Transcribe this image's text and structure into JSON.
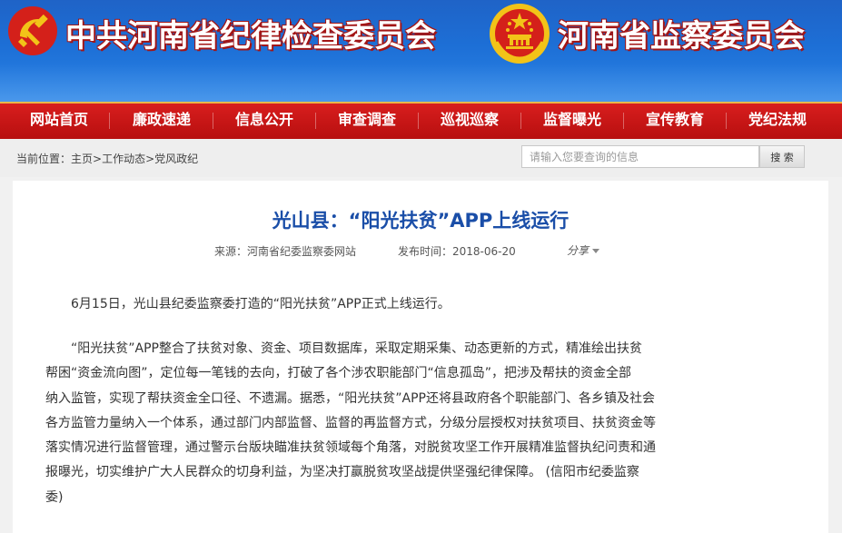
{
  "header": {
    "title_left": "中共河南省纪律检查委员会",
    "title_right": "河南省监察委员会",
    "left_emblem_icon": "hammer-sickle-emblem-icon",
    "right_emblem_icon": "national-emblem-icon"
  },
  "nav": {
    "items": [
      {
        "label": "网站首页"
      },
      {
        "label": "廉政速递"
      },
      {
        "label": "信息公开"
      },
      {
        "label": "审查调查"
      },
      {
        "label": "巡视巡察"
      },
      {
        "label": "监督曝光"
      },
      {
        "label": "宣传教育"
      },
      {
        "label": "党纪法规"
      }
    ]
  },
  "breadcrumb": {
    "prefix": "当前位置：",
    "items": [
      "主页",
      "工作动态",
      "党风政纪"
    ],
    "sep": ">"
  },
  "search": {
    "placeholder": "请输入您要查询的信息",
    "button_label": "搜 索"
  },
  "article": {
    "title": "光山县：“阳光扶贫”APP上线运行",
    "source_label": "来源：",
    "source": "河南省纪委监察委网站",
    "date_label": "发布时间：",
    "date": "2018-06-20",
    "share_label": "分享",
    "paragraph1": [
      "6月15日，光山县纪委监察委打造的“阳光扶贫”APP正式上线运行。"
    ],
    "paragraph2": [
      "“阳光扶贫”APP整合了扶贫对象、资金、项目数据库，采取定期采集、动态更新的方式，精准绘出扶贫",
      "帮困“资金流向图”，定位每一笔钱的去向，打破了各个涉农职能部门“信息孤岛”，把涉及帮扶的资金全部",
      "纳入监管，实现了帮扶资金全口径、不遗漏。据悉，“阳光扶贫”APP还将县政府各个职能部门、各乡镇及社会",
      "各方监管力量纳入一个体系，通过部门内部监督、监督的再监督方式，分级分层授权对扶贫项目、扶贫资金等",
      "落实情况进行监督管理，通过警示台版块瞄准扶贫领域每个角落，对脱贫攻坚工作开展精准监督执纪问责和通",
      "报曝光，切实维护广大人民群众的切身利益，为坚决打赢脱贫攻坚战提供坚强纪律保障。 (信阳市纪委监察",
      "委)"
    ]
  },
  "colors": {
    "banner_blue": "#1d6fd6",
    "nav_red": "#c41414",
    "title_text": "#1a4ea8",
    "emblem_red": "#d4201a",
    "emblem_gold": "#f2c318"
  }
}
